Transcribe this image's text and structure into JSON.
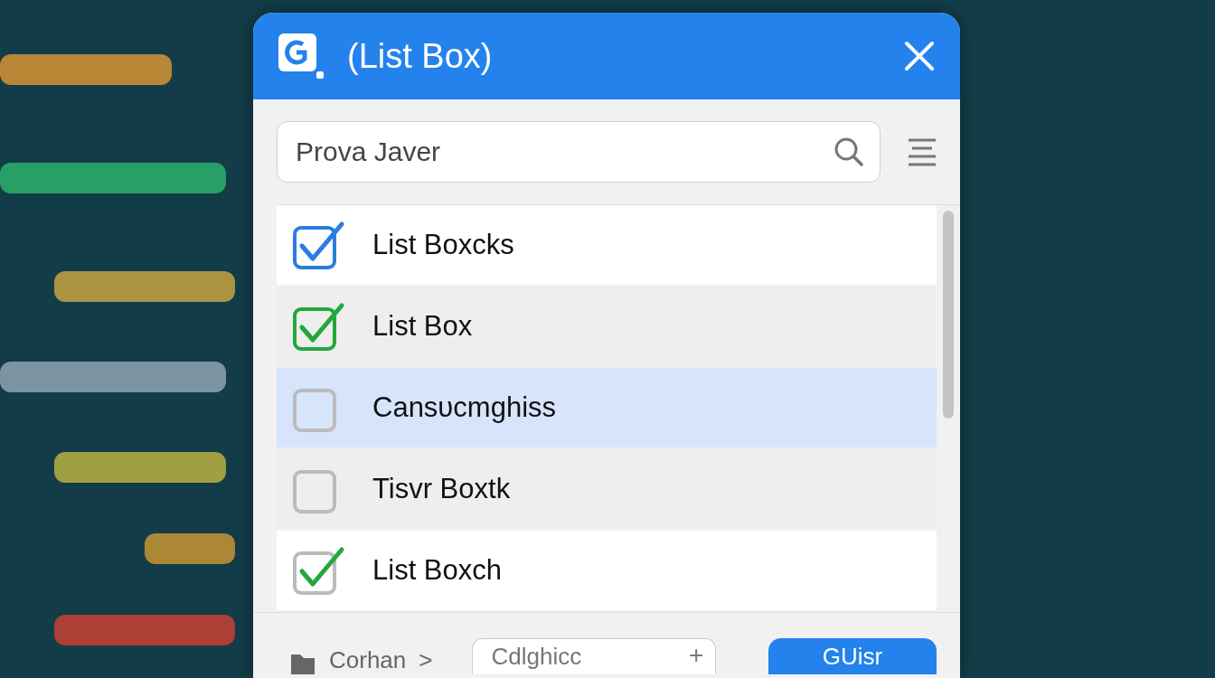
{
  "window": {
    "title": "(List Box)"
  },
  "search": {
    "value": "Prova Javer"
  },
  "items": [
    {
      "label": "List Boxcks",
      "checked": true,
      "selected": false,
      "kind": "boxed",
      "color": "#2a7de1"
    },
    {
      "label": "List Box",
      "checked": true,
      "selected": false,
      "kind": "boxed",
      "color": "#22a83a"
    },
    {
      "label": "Cansυcmghiss",
      "checked": false,
      "selected": true,
      "kind": "boxed"
    },
    {
      "label": "Tisvr Boxtk",
      "checked": false,
      "selected": false,
      "kind": "boxed"
    },
    {
      "label": "List Boxch",
      "checked": true,
      "selected": false,
      "kind": "tick",
      "color": "#22a83a"
    }
  ],
  "footer": {
    "breadcrumb": "Corhan",
    "separator": ">",
    "field": {
      "value": "Cdlghicc"
    },
    "add": "+",
    "button": "GUisr"
  }
}
